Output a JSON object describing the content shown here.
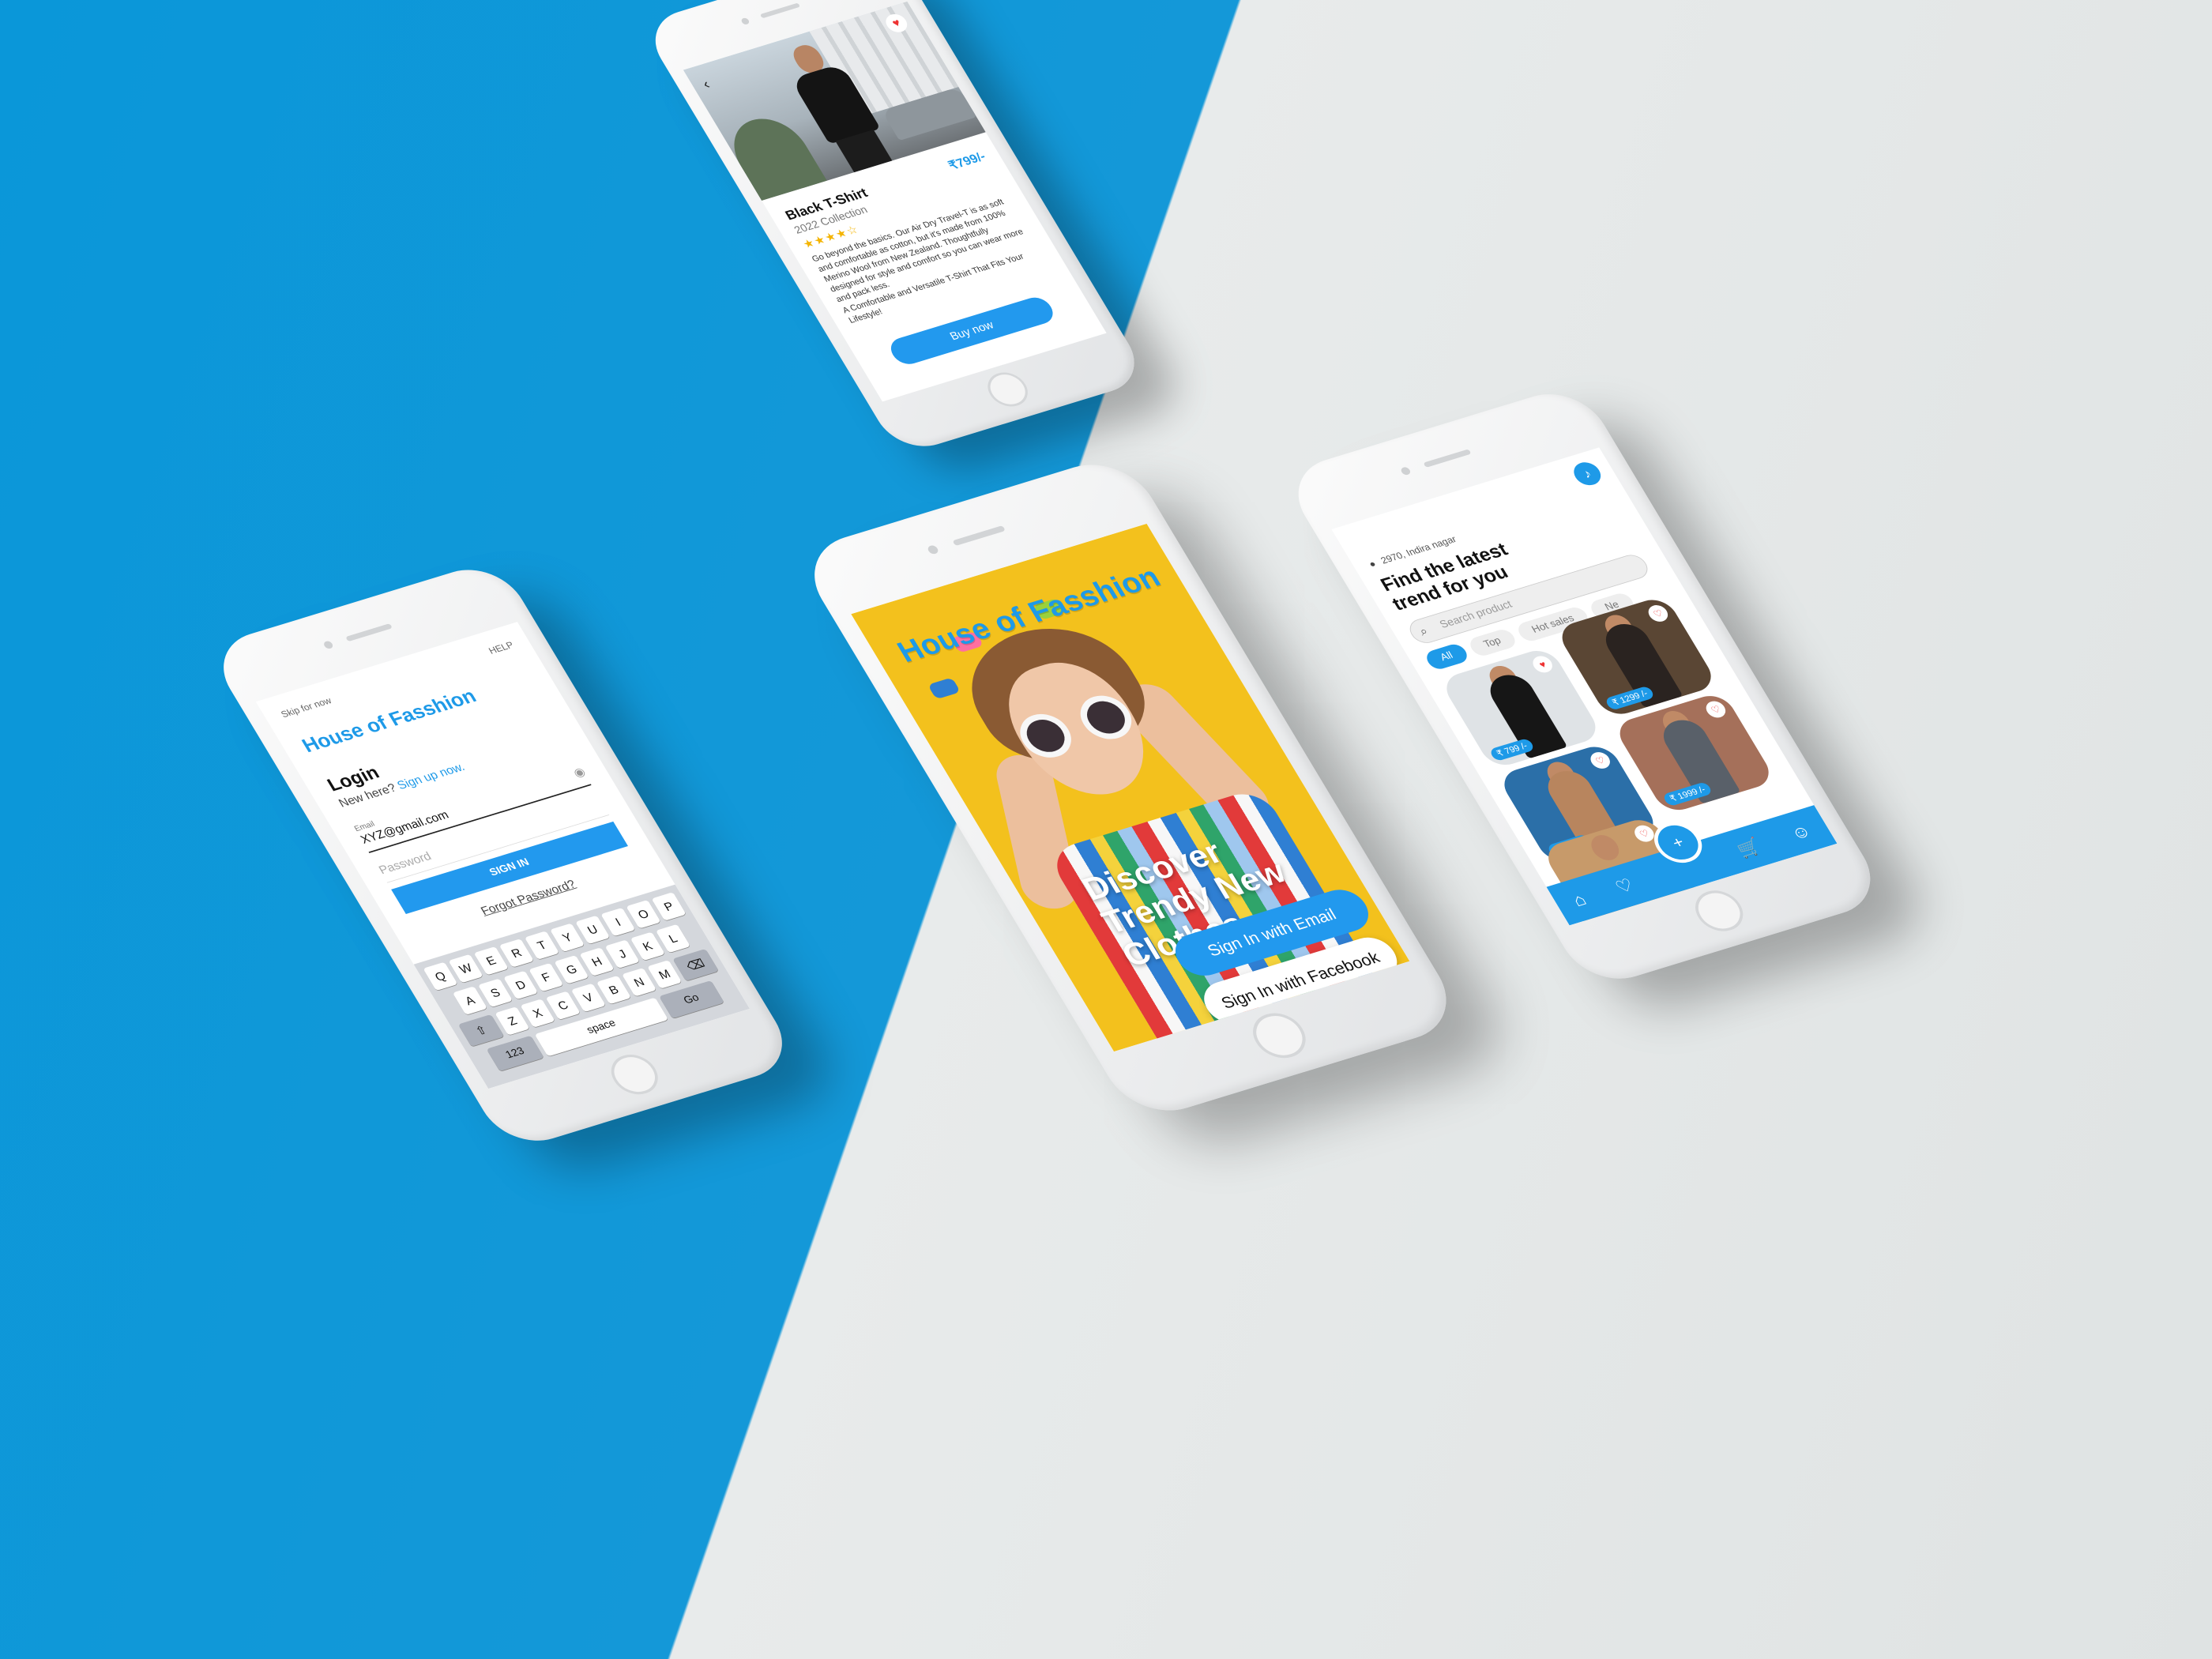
{
  "colors": {
    "accent": "#1e9ae8",
    "background_left": "#1498d8",
    "background_right": "#e3e6e6",
    "welcome_bg": "#f3c11d"
  },
  "product": {
    "back_icon": "chevron-left-icon",
    "favorite_icon": "heart-icon",
    "title": "Black T-Shirt",
    "price": "₹799/-",
    "collection": "2022 Collection",
    "rating": 4,
    "stars": "★★★★☆",
    "description": "Go beyond the basics. Our Air Dry Travel-T is as soft and comfortable as cotton, but it's made from 100% Merino Wool from New Zealand. Thoughtfully designed for style and comfort so you can wear more and pack less.",
    "tagline": "A Comfortable and Versatile T-Shirt That Fits Your Lifestyle!",
    "buy_label": "Buy now"
  },
  "login": {
    "skip": "Skip for now",
    "help": "HELP",
    "brand": "House of Fasshion",
    "heading": "Login",
    "new_here": "New here?",
    "signup": "Sign up now.",
    "email_label": "Email",
    "email_value": "XYZ@gmail.com",
    "password_placeholder": "Password",
    "signin_label": "SIGN IN",
    "forgot": "Forgot Password?",
    "keyboard": {
      "row1": [
        "Q",
        "W",
        "E",
        "R",
        "T",
        "Y",
        "U",
        "I",
        "O",
        "P"
      ],
      "row2": [
        "A",
        "S",
        "D",
        "F",
        "G",
        "H",
        "J",
        "K",
        "L"
      ],
      "row3": [
        "Z",
        "X",
        "C",
        "V",
        "B",
        "N",
        "M"
      ],
      "shift": "⇧",
      "backspace": "⌫",
      "numbers": "123",
      "space": "space",
      "go": "Go",
      "mic": "🎤",
      "emoji": "☺"
    }
  },
  "welcome": {
    "brand": "House of Fasshion",
    "headline": "Discover Trendy New Clothes",
    "email_btn": "Sign In with Email",
    "facebook_btn": "Sign In with Facebook"
  },
  "home": {
    "bell_icon": "bell-icon",
    "location": "2970, Indira nagar",
    "heading": "Find the latest trend for you",
    "search_placeholder": "Search product",
    "chips": [
      "All",
      "Top",
      "Hot sales",
      "Ne"
    ],
    "products": [
      {
        "price": "₹ 799 /-"
      },
      {
        "price": "₹ 1299 /-"
      },
      {
        "price": "₹ 999 /-"
      },
      {
        "price": "₹ 1999 /-"
      },
      {
        "price": ""
      }
    ]
  }
}
